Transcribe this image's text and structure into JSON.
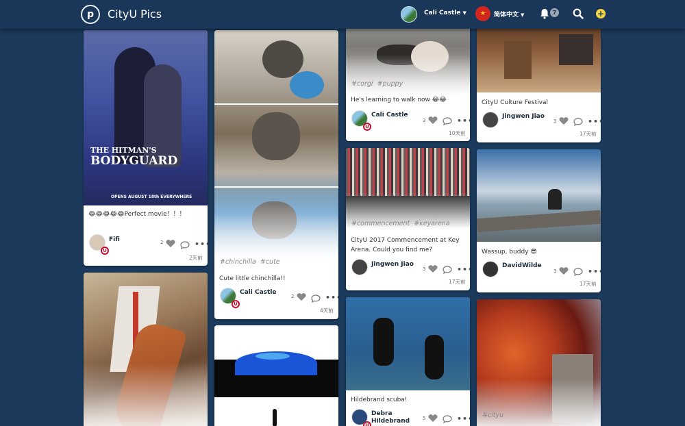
{
  "nav": {
    "brand": "CityU Pics",
    "logo_glyph": "p",
    "user": "Cali Castle",
    "language": "简体中文",
    "flag_glyph": "★",
    "notifications": "7"
  },
  "columns": [
    [
      {
        "caption": "😂😂😂😂😂Perfect movie！！！",
        "user": "Fifi",
        "likes": "2",
        "time": "2天前",
        "tags": [],
        "poster": {
          "title_line1": "THE HITMAN'S",
          "title_line2": "BODYGUARD",
          "footer": "OPENS AUGUST 18th EVERYWHERE"
        }
      },
      {
        "caption": "",
        "user": "",
        "likes": "",
        "time": "",
        "tags": []
      }
    ],
    [
      {
        "caption": "Cute little chinchilla!!",
        "user": "Cali Castle",
        "likes": "2",
        "time": "4天前",
        "tags": [
          "#chinchilla",
          "#cute"
        ]
      },
      {
        "caption": "",
        "user": "",
        "likes": "",
        "time": "",
        "tags": []
      }
    ],
    [
      {
        "caption": "He's learning to walk now 😂😂",
        "user": "Cali Castle",
        "likes": "3",
        "time": "10天前",
        "tags": [
          "#corgi",
          "#puppy"
        ]
      },
      {
        "caption": "CityU 2017 Commencement at Key Arena. Could you find me?",
        "user": "Jingwen Jiao",
        "likes": "3",
        "time": "17天前",
        "tags": [
          "#commencement",
          "#keyarena"
        ]
      },
      {
        "caption": "Hildebrand scuba!",
        "user": "Debra Hildebrand",
        "likes": "5",
        "time": "",
        "tags": []
      }
    ],
    [
      {
        "caption": "CityU Culture Festival",
        "user": "Jingwen Jiao",
        "likes": "3",
        "time": "17天前",
        "tags": []
      },
      {
        "caption": "Wassup, buddy 😎",
        "user": "DavidWilde",
        "likes": "3",
        "time": "17天前",
        "tags": []
      },
      {
        "caption": "",
        "user": "",
        "likes": "",
        "time": "",
        "tags": [
          "#cityu"
        ]
      }
    ]
  ],
  "colors": {
    "background": "#1b3a5c",
    "nav": "#1a3759",
    "badge": "#c8102e",
    "add": "#f5d442"
  }
}
